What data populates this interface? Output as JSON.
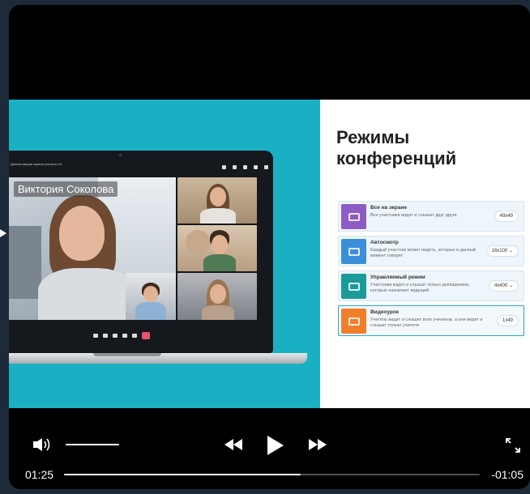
{
  "slide": {
    "speaker_name": "Виктория Соколова",
    "laptop_title": "Демонстрация экрана учителя 1/4",
    "title_line1": "Режимы",
    "title_line2": "конференций",
    "modes": [
      {
        "name": "Все на экране",
        "desc": "Все участники видят и слышат друг друга",
        "value": "49x49",
        "color": "#8e5bc6",
        "active": false
      },
      {
        "name": "Автосмотр",
        "desc": "Каждый участник может видеть, которые в данный момент говорят",
        "value": "16x100 ⌄",
        "color": "#3a8fd8",
        "active": false
      },
      {
        "name": "Управляемый режим",
        "desc": "Участники видят и слышат только докладчиков, которых назначает ведущий",
        "value": "4x400 ⌄",
        "color": "#1b9a9a",
        "active": false
      },
      {
        "name": "Видеоурок",
        "desc": "Учитель видит и слышит всех учеников, а они видят и слышат только учителя",
        "value": "1x49",
        "color": "#f07f2a",
        "active": true
      }
    ]
  },
  "player": {
    "current_time": "01:25",
    "remaining_time": "-01:05",
    "progress_fraction": 0.57,
    "volume_fraction": 1.0,
    "icons": {
      "volume": "volume-icon",
      "rewind": "rewind-icon",
      "play": "play-icon",
      "forward": "fast-forward-icon",
      "fullscreen": "fullscreen-icon"
    }
  }
}
